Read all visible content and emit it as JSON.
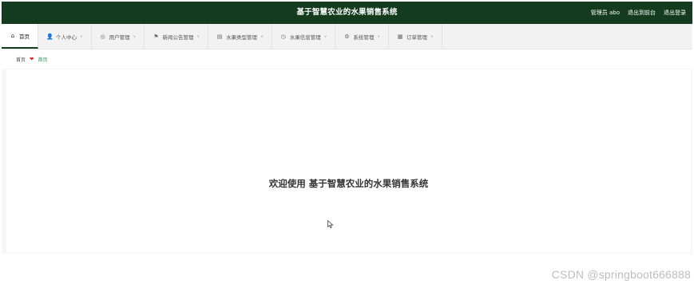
{
  "header": {
    "title": "基于智慧农业的水果销售系统",
    "admin_label": "管理员 abo",
    "back_to_front": "退出到前台",
    "logout": "退出登录",
    "background_color": "#143b1e"
  },
  "nav": {
    "items": [
      {
        "label": "首页",
        "icon": "home-icon",
        "active": true
      },
      {
        "label": "个人中心",
        "icon": "user-icon"
      },
      {
        "label": "用户管理",
        "icon": "users-icon"
      },
      {
        "label": "新闻公告管理",
        "icon": "flag-icon"
      },
      {
        "label": "水果类型管理",
        "icon": "list-icon"
      },
      {
        "label": "水果信息管理",
        "icon": "info-icon"
      },
      {
        "label": "系统管理",
        "icon": "settings-icon"
      },
      {
        "label": "订单管理",
        "icon": "order-icon"
      }
    ]
  },
  "breadcrumb": {
    "root": "首页",
    "current": "首页"
  },
  "main": {
    "welcome_text": "欢迎使用 基于智慧农业的水果销售系统"
  },
  "watermark": "CSDN @springboot666888"
}
